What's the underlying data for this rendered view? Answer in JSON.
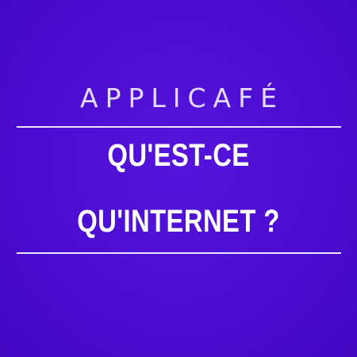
{
  "brand": {
    "name": "APPLICAFÉ"
  },
  "headline": {
    "line1": "QU'EST-CE",
    "line2": "QU'INTERNET ?"
  },
  "colors": {
    "background": "#4c0fd0",
    "brand_text": "#e4dcff",
    "headline_text": "#ffffff",
    "rule": "#e9e4ff"
  }
}
